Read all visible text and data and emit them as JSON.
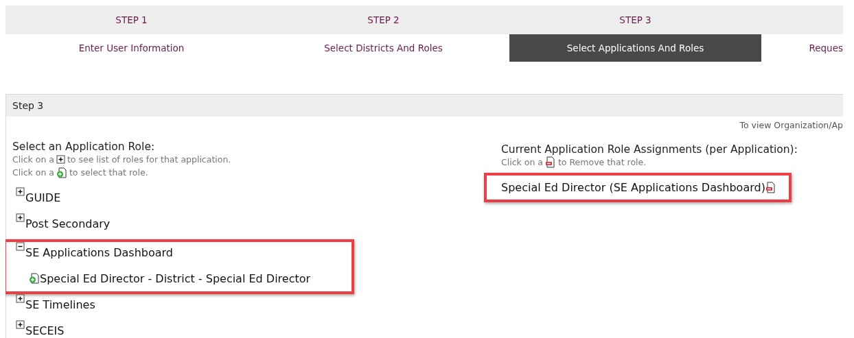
{
  "steps": [
    {
      "number": "STEP 1",
      "label": "Enter User Information",
      "selected": false
    },
    {
      "number": "STEP 2",
      "label": "Select Districts And Roles",
      "selected": false
    },
    {
      "number": "STEP 3",
      "label": "Select Applications And Roles",
      "selected": true
    },
    {
      "label": "Reques",
      "selected": false
    }
  ],
  "panel": {
    "title": "Step 3",
    "info": "To view Organization/Ap",
    "left": {
      "title": "Select an Application Role:",
      "hints": [
        {
          "before": "Click on a",
          "kind": "expand",
          "after": "to see list of roles for that application."
        },
        {
          "before": "Click on a",
          "kind": "add",
          "after": "to select that role."
        }
      ],
      "tree": [
        {
          "label": "GUIDE",
          "expanded": false,
          "highlighted": false
        },
        {
          "label": "Post Secondary",
          "expanded": false,
          "highlighted": false
        },
        {
          "label": "SE Applications Dashboard",
          "expanded": true,
          "highlighted": true,
          "children": [
            {
              "label": "Special Ed Director - District - Special Ed Director"
            }
          ]
        },
        {
          "label": "SE Timelines",
          "expanded": false,
          "highlighted": false
        },
        {
          "label": "SECEIS",
          "expanded": false,
          "highlighted": false
        }
      ]
    },
    "right": {
      "title": "Current Application Role Assignments (per Application):",
      "hints": [
        {
          "before": "Click on a",
          "kind": "remove",
          "after": "to Remove that role."
        }
      ],
      "assignments": [
        {
          "label": "Special Ed Director (SE Applications Dashboard)",
          "highlighted": true
        }
      ]
    }
  }
}
